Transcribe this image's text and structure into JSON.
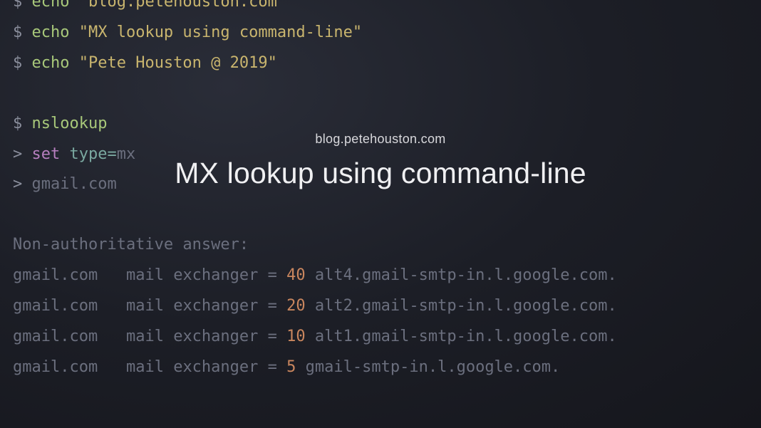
{
  "overlay": {
    "subtitle": "blog.petehouston.com",
    "title": "MX lookup using command-line"
  },
  "terminal": {
    "lines": [
      {
        "prompt": "$ ",
        "cmd": "echo",
        "cmdClass": "cmd-green",
        "rest": " \"blog.petehouston.com\"",
        "restClass": "cmd-yellow"
      },
      {
        "prompt": "$ ",
        "cmd": "echo",
        "cmdClass": "cmd-green",
        "rest": " \"MX lookup using command-line\"",
        "restClass": "cmd-yellow"
      },
      {
        "prompt": "$ ",
        "cmd": "echo",
        "cmdClass": "cmd-green",
        "rest": " \"Pete Houston @ 2019\"",
        "restClass": "cmd-yellow"
      }
    ],
    "nslookup": {
      "prompt": "$ ",
      "cmd": "nslookup",
      "setLine": {
        "prompt": "> ",
        "kw": "set",
        "var": "type",
        "eq": "=",
        "val": "mx"
      },
      "queryLine": {
        "prompt": "> ",
        "domain": "gmail.com"
      }
    },
    "answerHeader": "Non-authoritative answer:",
    "records": [
      {
        "domain": "gmail.com",
        "label": "mail exchanger",
        "eq": "=",
        "priority": "40",
        "host": "alt4.gmail-smtp-in.l.google.com."
      },
      {
        "domain": "gmail.com",
        "label": "mail exchanger",
        "eq": "=",
        "priority": "20",
        "host": "alt2.gmail-smtp-in.l.google.com."
      },
      {
        "domain": "gmail.com",
        "label": "mail exchanger",
        "eq": "=",
        "priority": "10",
        "host": "alt1.gmail-smtp-in.l.google.com."
      },
      {
        "domain": "gmail.com",
        "label": "mail exchanger",
        "eq": "=",
        "priority": "5",
        "host": "gmail-smtp-in.l.google.com."
      }
    ]
  }
}
